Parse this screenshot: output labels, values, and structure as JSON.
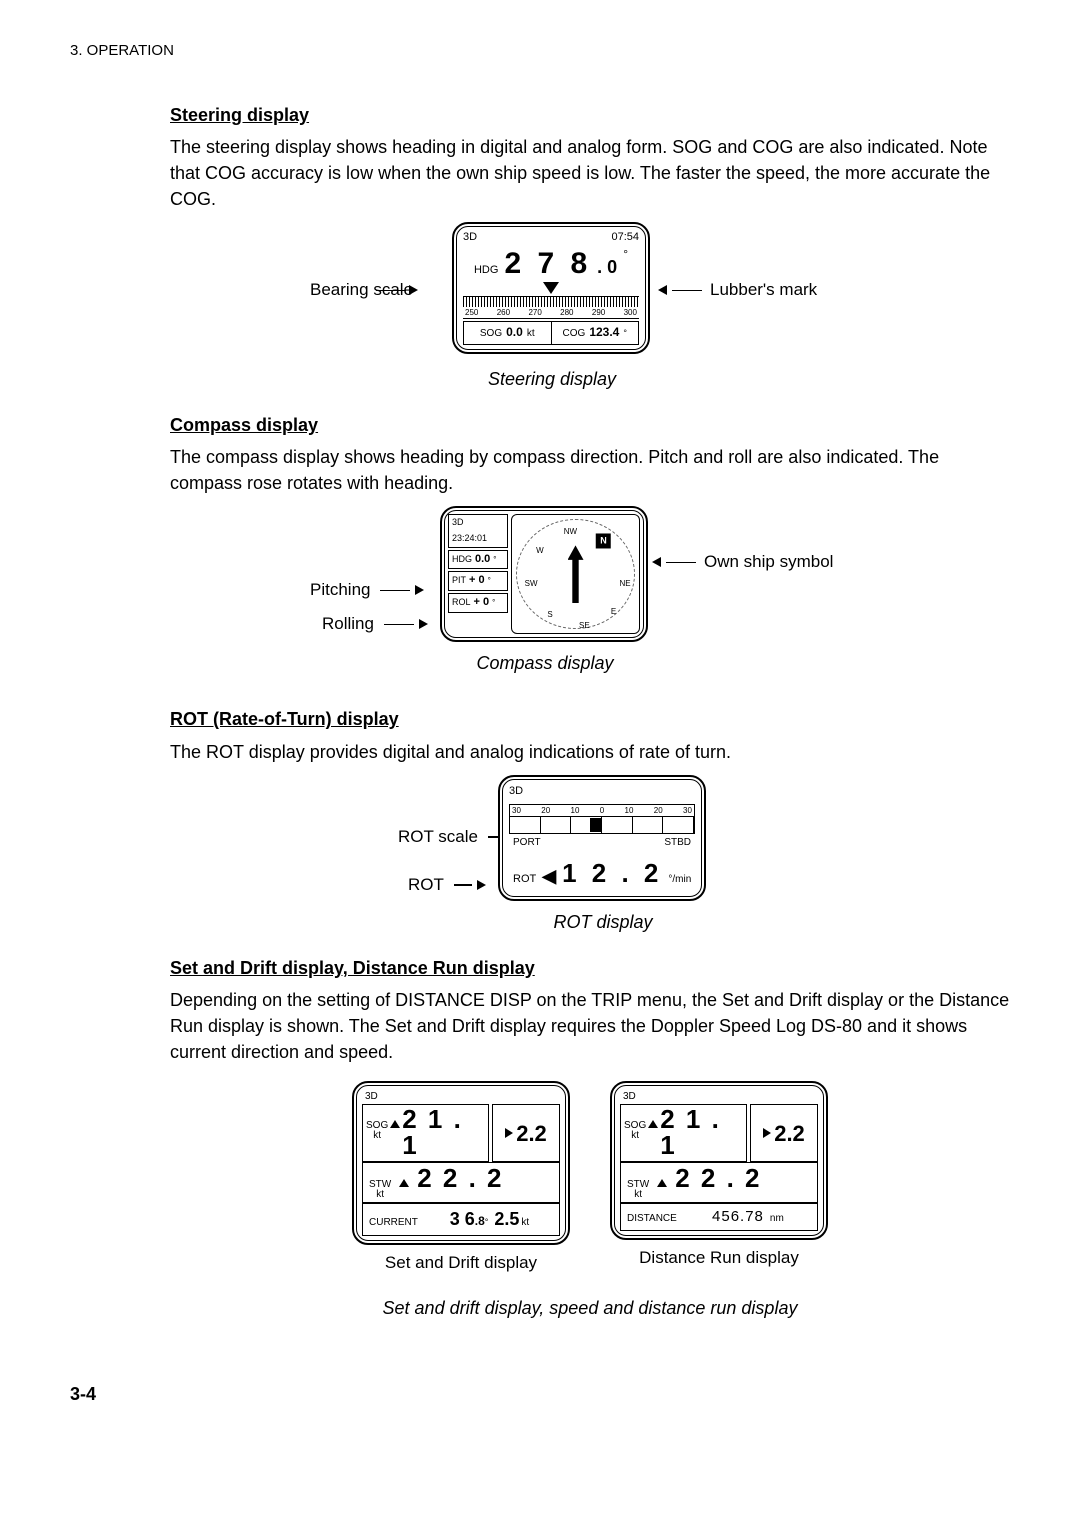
{
  "section_tag": "3. OPERATION",
  "page_num": "3-4",
  "steering": {
    "heading": "Steering display",
    "para": "The steering display shows heading in digital and analog form. SOG and COG are also indicated. Note that COG accuracy is low when the own ship speed is low. The faster the speed, the more accurate the COG.",
    "callout_bearing": "Bearing scale",
    "callout_lubber": "Lubber's mark",
    "fig": {
      "mode": "3D",
      "time": "07:54",
      "hdg_lbl": "HDG",
      "hdg_int": "2 7 8",
      "hdg_dec": ". 0",
      "scale": [
        "250",
        "260",
        "270",
        "280",
        "290",
        "300"
      ],
      "sog_lbl": "SOG",
      "sog_val": "0.0",
      "sog_unit": "kt",
      "cog_lbl": "COG",
      "cog_val": "123.4"
    },
    "caption": "Steering display"
  },
  "compass": {
    "heading": "Compass display",
    "para": "The compass display shows heading by compass direction. Pitch and roll are also indicated. The compass rose rotates with heading.",
    "callout_pitch": "Pitching",
    "callout_roll": "Rolling",
    "callout_own": "Own ship symbol",
    "fig": {
      "mode": "3D",
      "time": "23:24:01",
      "hdg_lbl": "HDG",
      "hdg_val": "0.0",
      "pit_lbl": "PIT",
      "pit_val": "+ 0",
      "rol_lbl": "ROL",
      "rol_val": "+ 0",
      "dirs": {
        "n": "N",
        "ne": "NE",
        "e": "E",
        "se": "SE",
        "s": "S",
        "sw": "SW",
        "w": "W",
        "nw": "NW"
      }
    },
    "caption": "Compass display"
  },
  "rot": {
    "heading": "ROT (Rate-of-Turn) display",
    "para": "The ROT display provides digital and analog indications of rate of turn.",
    "callout_scale": "ROT scale",
    "callout_rot": "ROT",
    "fig": {
      "mode": "3D",
      "nums": [
        "30",
        "20",
        "10",
        "0",
        "10",
        "20",
        "30"
      ],
      "port": "PORT",
      "stbd": "STBD",
      "lbl": "ROT",
      "arrow": "◀",
      "val": "1 2 . 2",
      "unit": "°/min"
    },
    "caption": "ROT display"
  },
  "sdd": {
    "heading": "Set and Drift display, Distance Run display",
    "para": "Depending on the setting of DISTANCE DISP on the TRIP menu, the Set and Drift display or the Distance Run display is shown. The Set and Drift display requires the Doppler Speed Log DS-80 and it shows current direction and speed.",
    "left": {
      "mode": "3D",
      "sog_lbl": "SOG",
      "sog_unit": "kt",
      "sog_val": "2 1 . 1",
      "side_val": "2.2",
      "stw_lbl": "STW",
      "stw_unit": "kt",
      "stw_val": "2 2 . 2",
      "bot_lbl": "CURRENT",
      "cur_dir_int": "3 6",
      "cur_dir_dec": ".8",
      "cur_spd": "2.5",
      "cur_spd_unit": "kt",
      "caption": "Set and Drift display"
    },
    "right": {
      "mode": "3D",
      "sog_lbl": "SOG",
      "sog_unit": "kt",
      "sog_val": "2 1 . 1",
      "side_val": "2.2",
      "stw_lbl": "STW",
      "stw_unit": "kt",
      "stw_val": "2 2 . 2",
      "bot_lbl": "DISTANCE",
      "dist_val": "456.78",
      "dist_unit": "nm",
      "caption": "Distance Run display"
    },
    "caption": "Set and drift display, speed and distance run display"
  }
}
